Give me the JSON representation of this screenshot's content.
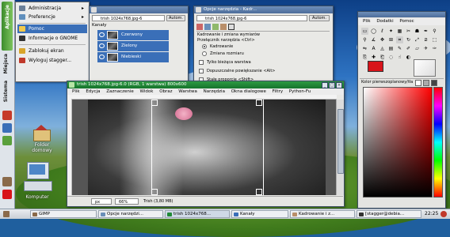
{
  "panel": {
    "start_label": "Sistema",
    "start_label_2": "Miejsca",
    "start_label_3": "Aplikacje"
  },
  "app_menu": {
    "items": [
      {
        "label": "Administracja",
        "icon": "admin-icon",
        "submenu": true
      },
      {
        "label": "Preferencje",
        "icon": "preferences-icon",
        "submenu": true
      },
      {
        "label": "Pomoc",
        "icon": "help-icon",
        "submenu": false
      },
      {
        "label": "Informacje o GNOME",
        "icon": "gnome-icon",
        "submenu": false
      },
      {
        "label": "Zablokuj ekran",
        "icon": "lock-icon",
        "submenu": false
      },
      {
        "label": "Wyloguj stagger...",
        "icon": "logout-icon",
        "submenu": false
      }
    ],
    "submenu_arrow": "▸"
  },
  "channels_window": {
    "image_combo": "trish 1024x768.jpg-6",
    "auto_button": "Autom.",
    "section_label": "Kanały",
    "channels": [
      "Czerwony",
      "Zielony",
      "Niebieski"
    ]
  },
  "tool_options_window": {
    "title": "Opcje narzędzia - Kadr...",
    "image_combo": "trish 1024x768.jpg-6",
    "auto_button": "Autom.",
    "header": "Kadrowanie i zmiana wymiarów",
    "toggle_label": "Przełącznik narzędzia  <Ctrl>",
    "mode_crop": "Kadrowanie",
    "mode_resize": "Zmiana rozmiaru",
    "opt_current_layer": "Tylko bieżąca warstwa",
    "opt_enlarge": "Dopuszczalne powiększanie  <Alt>",
    "opt_fixed": "Stałe proporcje  <Shift>"
  },
  "image_window": {
    "title": "trish 1024x768.jpg-6.0 (RGB, 1 warstwa) 800x600",
    "menu": [
      "Plik",
      "Edycja",
      "Zaznaczenie",
      "Widok",
      "Obraz",
      "Warstwa",
      "Narzędzia",
      "Okna dialogowe",
      "Filtry",
      "Python-Fu"
    ],
    "unit": "px",
    "zoom": "66%",
    "status": "Trish (3,80 MB)"
  },
  "toolbox": {
    "menu": [
      "Plik",
      "Dodatki",
      "Pomoc"
    ],
    "fg_color": "#d8141a",
    "bg_color": "#f0f0f0",
    "fg_label": "Kolor pierwszoplanowy/tła"
  },
  "desktop": {
    "folder_label_1": "Folder",
    "folder_label_2": "domowy",
    "computer_label": "Komputer"
  },
  "taskbar": {
    "items": [
      {
        "label": "GIMP",
        "icon": "gimp-icon"
      },
      {
        "label": "Opcje narzędzi...",
        "icon": "tool-options-icon"
      },
      {
        "label": "trish 1024x768...",
        "icon": "image-icon"
      },
      {
        "label": "Kanały",
        "icon": "channels-icon"
      },
      {
        "label": "Kadrowanie i z...",
        "icon": "crop-icon"
      },
      {
        "label": "[stagger@debia...",
        "icon": "terminal-icon"
      }
    ],
    "clock": "22:25"
  },
  "colors": {
    "selection": "#3a6fb8",
    "title_green": "#1f8a37",
    "fg": "#d8141a"
  }
}
